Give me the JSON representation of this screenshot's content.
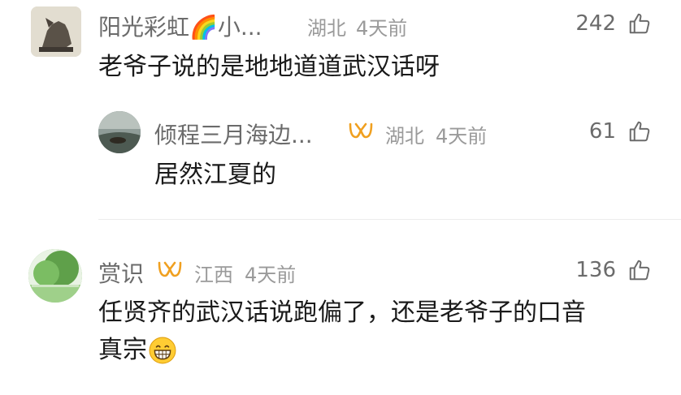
{
  "comments": [
    {
      "username": "阳光彩虹🌈小...",
      "location": "湖北",
      "time": "4天前",
      "likes": "242",
      "text": "老爷子说的是地地道道武汉话呀",
      "replies": [
        {
          "username": "倾程三月海边...",
          "location": "湖北",
          "time": "4天前",
          "likes": "61",
          "text": "居然江夏的"
        }
      ]
    },
    {
      "username": "赏识",
      "location": "江西",
      "time": "4天前",
      "likes": "136",
      "text_line1": "任贤齐的武汉话说跑偏了，还是老爷子的口音",
      "text_line2": "真宗"
    }
  ],
  "colors": {
    "name": "#6b6b6b",
    "meta": "#9a9a9a",
    "badge": "#f0a020",
    "text": "#1a1a1a"
  }
}
